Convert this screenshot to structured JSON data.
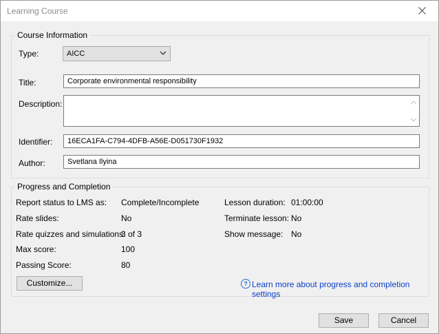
{
  "window": {
    "title": "Learning Course"
  },
  "course_info": {
    "legend": "Course Information",
    "type_label": "Type:",
    "type_value": "AICC",
    "title_label": "Title:",
    "title_value": "Corporate environmental responsibility",
    "description_label": "Description:",
    "description_value": "",
    "identifier_label": "Identifier:",
    "identifier_value": "16ECA1FA-C794-4DFB-A56E-D051730F1932",
    "author_label": "Author:",
    "author_value": "Svetlana Ilyina"
  },
  "progress": {
    "legend": "Progress and Completion",
    "report_label": "Report status to LMS as:",
    "report_value": "Complete/Incomplete",
    "rate_slides_label": "Rate slides:",
    "rate_slides_value": "No",
    "rate_quizzes_label": "Rate quizzes and simulations:",
    "rate_quizzes_value": "3 of 3",
    "max_score_label": "Max score:",
    "max_score_value": "100",
    "passing_label": "Passing Score:",
    "passing_value": "80",
    "lesson_duration_label": "Lesson duration:",
    "lesson_duration_value": "01:00:00",
    "terminate_label": "Terminate lesson:",
    "terminate_value": "No",
    "show_message_label": "Show message:",
    "show_message_value": "No",
    "customize_label": "Customize...",
    "help_link": "Learn more about progress and completion settings"
  },
  "footer": {
    "save_label": "Save",
    "cancel_label": "Cancel"
  }
}
